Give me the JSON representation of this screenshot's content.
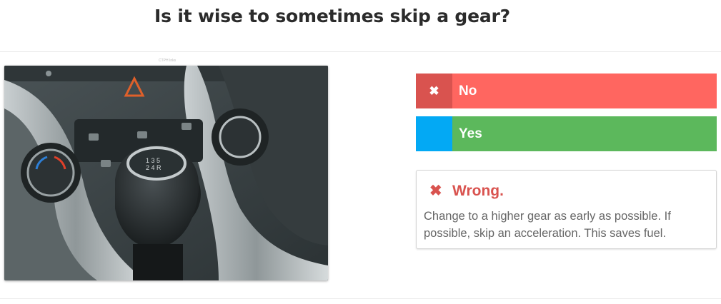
{
  "question": {
    "title": "Is it wise to sometimes skip a gear?",
    "image_credit": "CTPH Inks",
    "image_alt": "Manual car gear shift knob and climate controls"
  },
  "answers": [
    {
      "marker_icon": "close-icon",
      "marker_glyph": "✖",
      "label": "No",
      "color": "#ff6660",
      "marker_color": "#d9534f"
    },
    {
      "marker_icon": "",
      "marker_glyph": "",
      "label": "Yes",
      "color": "#5cb85c",
      "marker_color": "#03a9f4"
    }
  ],
  "feedback": {
    "icon": "close-icon",
    "glyph": "✖",
    "verdict": "Wrong.",
    "explanation": "Change to a higher gear as early as possible. If possible, skip an acceleration. This saves fuel.",
    "color": "#d9534f"
  }
}
